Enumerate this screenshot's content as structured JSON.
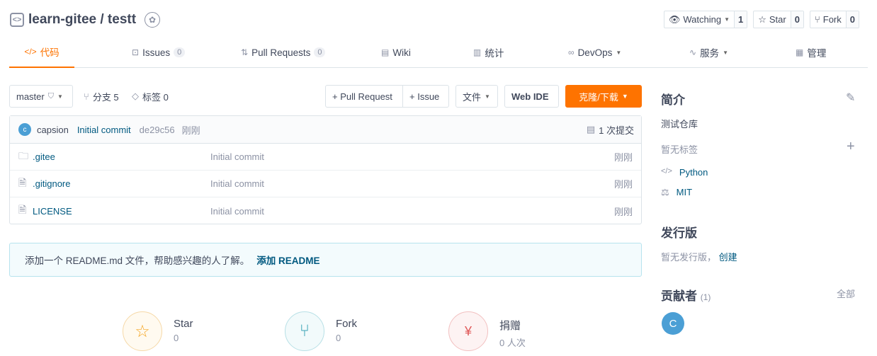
{
  "header": {
    "repo_title": "learn-gitee / testt",
    "watch_label": "Watching",
    "watch_count": "1",
    "star_label": "Star",
    "star_count": "0",
    "fork_label": "Fork",
    "fork_count": "0"
  },
  "tabs": [
    {
      "label": "代码",
      "icon": "code-icon"
    },
    {
      "label": "Issues",
      "count": "0",
      "icon": "issues-icon"
    },
    {
      "label": "Pull Requests",
      "count": "0",
      "icon": "pull-request-icon"
    },
    {
      "label": "Wiki",
      "icon": "wiki-icon"
    },
    {
      "label": "统计",
      "icon": "chart-icon"
    },
    {
      "label": "DevOps",
      "icon": "devops-icon"
    },
    {
      "label": "服务",
      "icon": "pulse-icon"
    },
    {
      "label": "管理",
      "icon": "doc-icon"
    }
  ],
  "toolbar": {
    "branch": "master",
    "branches": "分支 5",
    "tags": "标签 0",
    "pull_request": "+ Pull Request",
    "issue": "+ Issue",
    "file": "文件",
    "web_ide": "Web IDE",
    "clone": "克隆/下载"
  },
  "commit": {
    "avatar": "c",
    "author": "capsion",
    "message": "Initial commit",
    "hash": "de29c56",
    "time": "刚刚",
    "total": "1 次提交"
  },
  "files": [
    {
      "name": ".gitee",
      "type": "folder",
      "message": "Initial commit",
      "time": "刚刚"
    },
    {
      "name": ".gitignore",
      "type": "file",
      "message": "Initial commit",
      "time": "刚刚"
    },
    {
      "name": "LICENSE",
      "type": "file",
      "message": "Initial commit",
      "time": "刚刚"
    }
  ],
  "readme_notice": {
    "text": "添加一个 README.md 文件，帮助感兴趣的人了解。",
    "link": "添加 README"
  },
  "stats": [
    {
      "name": "Star",
      "value": "0",
      "icon": "star-icon",
      "color": "#f5a623"
    },
    {
      "name": "Fork",
      "value": "0",
      "icon": "fork-icon",
      "color": "#3aa3b5"
    },
    {
      "name": "捐赠",
      "value": "0 人次",
      "icon": "donate-icon",
      "color": "#e05a5a"
    }
  ],
  "sidebar": {
    "intro_title": "简介",
    "description": "测试仓库",
    "no_tags": "暂无标签",
    "language": "Python",
    "license": "MIT",
    "release_title": "发行版",
    "no_release": "暂无发行版，",
    "create": "创建",
    "contributors_title": "贡献者",
    "contributors_count": "(1)",
    "all": "全部",
    "contributor_avatar": "C"
  },
  "colors": {
    "accent": "#fe7300",
    "link": "#005980",
    "border": "#dce3e8"
  }
}
